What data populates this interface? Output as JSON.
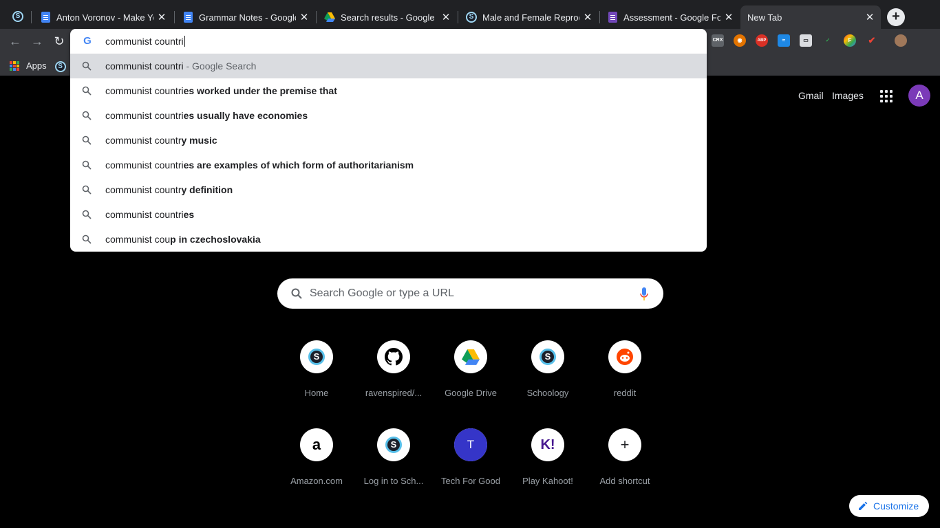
{
  "tabs": [
    {
      "title": "Anton Voronov - Make Yo",
      "icon": "docs-icon"
    },
    {
      "title": "Grammar Notes - Google",
      "icon": "docs-icon"
    },
    {
      "title": "Search results - Google D",
      "icon": "drive-icon"
    },
    {
      "title": "Male and Female Reprod",
      "icon": "schoology-icon"
    },
    {
      "title": "Assessment - Google For",
      "icon": "forms-icon"
    },
    {
      "title": "New Tab",
      "icon": "",
      "active": true
    }
  ],
  "bookmarks": {
    "apps_label": "Apps"
  },
  "omnibox": {
    "text": "communist countri",
    "suggestions": [
      {
        "typed": "communist countri",
        "rest": "",
        "desc": " - Google Search"
      },
      {
        "typed": "communist countri",
        "rest": "es worked under the premise that",
        "desc": ""
      },
      {
        "typed": "communist countri",
        "rest": "es usually have economies",
        "desc": ""
      },
      {
        "typed": "communist countr",
        "rest": "y music",
        "desc": ""
      },
      {
        "typed": "communist countri",
        "rest": "es are examples of which form of authoritarianism",
        "desc": ""
      },
      {
        "typed": "communist countr",
        "rest": "y definition",
        "desc": ""
      },
      {
        "typed": "communist countri",
        "rest": "es",
        "desc": ""
      },
      {
        "typed": "communist cou",
        "rest": "p in czechoslovakia",
        "desc": ""
      }
    ]
  },
  "header": {
    "gmail": "Gmail",
    "images": "Images",
    "avatar_letter": "A"
  },
  "search": {
    "placeholder": "Search Google or type a URL"
  },
  "shortcuts": [
    {
      "label": "Home",
      "icon": "schoology-icon"
    },
    {
      "label": "ravenspired/...",
      "icon": "github-icon"
    },
    {
      "label": "Google Drive",
      "icon": "drive-icon"
    },
    {
      "label": "Schoology",
      "icon": "schoology-icon"
    },
    {
      "label": "reddit",
      "icon": "reddit-icon"
    },
    {
      "label": "Amazon.com",
      "icon": "amazon-icon",
      "glyph": "a"
    },
    {
      "label": "Log in to Sch...",
      "icon": "schoology-icon"
    },
    {
      "label": "Tech For Good",
      "icon": "letter-t-icon",
      "glyph": "T"
    },
    {
      "label": "Play Kahoot!",
      "icon": "kahoot-icon",
      "glyph": "K!"
    },
    {
      "label": "Add shortcut",
      "icon": "plus-icon",
      "glyph": "+"
    }
  ],
  "customize_label": "Customize",
  "extensions": [
    "CRX",
    "ABP"
  ],
  "colors": {
    "omnibox_selected": "#dadce0",
    "accent_blue": "#1a73e8",
    "avatar": "#7b3ab8"
  }
}
